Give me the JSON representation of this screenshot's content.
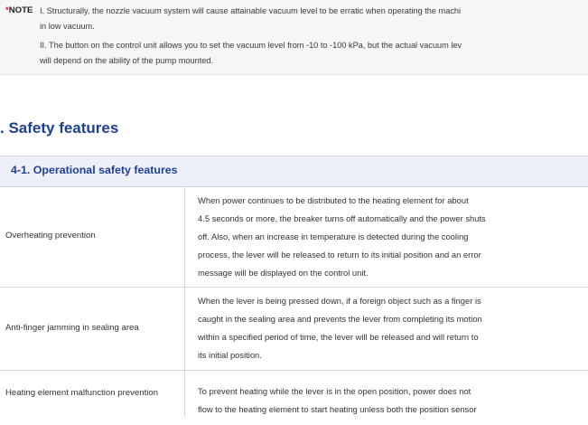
{
  "note": {
    "label_star": "*",
    "label_text": "NOTE",
    "lines": [
      "I. Structurally, the nozzle vacuum system will cause attainable vacuum level to be erratic when operating the machi",
      "in low vacuum.",
      "II. The button on the control unit allows you to set the vacuum level from -10 to -100 kPa, but the actual vacuum lev",
      "will depend on the ability of the pump mounted."
    ]
  },
  "section": {
    "title": ". Safety features"
  },
  "table": {
    "header": "4-1. Operational safety features",
    "rows": [
      {
        "label": "Overheating prevention",
        "desc": [
          "When power continues to be distributed to the heating element for about",
          "4.5 seconds or more, the breaker turns off automatically and the power shuts",
          "off. Also, when an increase in temperature is detected during the cooling",
          "process, the lever will be released to return to its initial position and an error",
          "message will be displayed on the control unit."
        ]
      },
      {
        "label": "Anti-finger jamming in sealing area",
        "desc": [
          "When the lever is being pressed down, if a foreign object such as a finger is",
          "caught in the sealing area and prevents the lever from completing its motion",
          "within a specified period of time, the lever will be released and will return to",
          "its initial position."
        ]
      },
      {
        "label": "Heating element malfunction prevention",
        "desc": [
          "To prevent heating while the lever is in the open position, power does not",
          "flow to the heating element to start heating unless both the position sensor"
        ]
      }
    ]
  }
}
